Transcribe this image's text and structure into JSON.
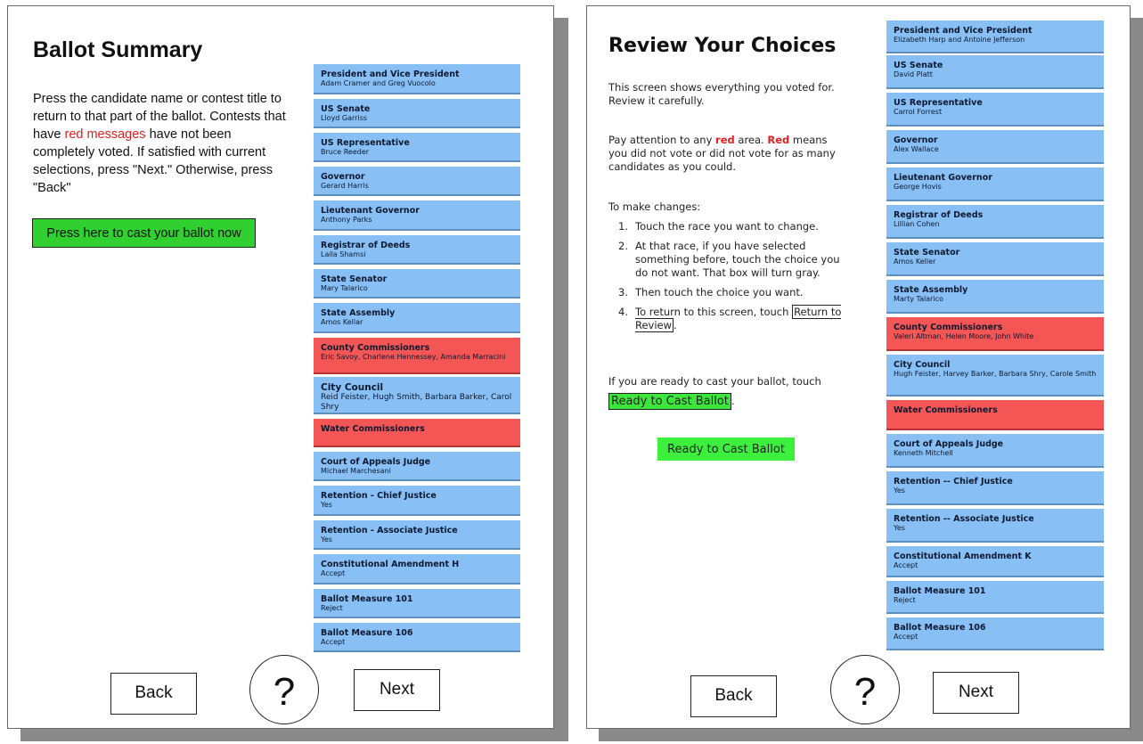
{
  "left_screen": {
    "title": "Ballot Summary",
    "instructions": {
      "part1": "Press the candidate name or contest title to return to that part of the ballot. Contests that have ",
      "red": "red messages",
      "part2": " have not been completely voted.  If satisfied with current selections, press \"Next.\" Otherwise, press \"Back\""
    },
    "cast_button": "Press here to cast your ballot now",
    "contests": [
      {
        "title": "President and Vice President",
        "choice": "Adam Cramer and Greg Vuocolo",
        "status": "voted"
      },
      {
        "title": "US Senate",
        "choice": "Lloyd Garriss",
        "status": "voted"
      },
      {
        "title": "US Representative",
        "choice": "Bruce Reeder",
        "status": "voted"
      },
      {
        "title": "Governor",
        "choice": "Gerard Harris",
        "status": "voted"
      },
      {
        "title": "Lieutenant Governor",
        "choice": "Anthony Parks",
        "status": "voted"
      },
      {
        "title": "Registrar of Deeds",
        "choice": "Laila Shamsi",
        "status": "voted"
      },
      {
        "title": "State Senator",
        "choice": "Mary Talarico",
        "status": "voted"
      },
      {
        "title": "State Assembly",
        "choice": "Amos Kellar",
        "status": "voted"
      },
      {
        "title": "County Commissioners",
        "choice": "Eric Savoy, Charlene Hennessey, Amanda Marracini",
        "status": "incomplete"
      },
      {
        "title": "City Council",
        "choice": "Reid Feister, Hugh Smith, Barbara Barker, Carol Shry",
        "status": "voted"
      },
      {
        "title": "Water Commissioners",
        "choice": "",
        "status": "incomplete"
      },
      {
        "title": "Court of Appeals Judge",
        "choice": "Michael Marchesani",
        "status": "voted"
      },
      {
        "title": "Retention - Chief Justice",
        "choice": "Yes",
        "status": "voted"
      },
      {
        "title": "Retention - Associate Justice",
        "choice": "Yes",
        "status": "voted"
      },
      {
        "title": "Constitutional Amendment H",
        "choice": "Accept",
        "status": "voted"
      },
      {
        "title": "Ballot Measure 101",
        "choice": "Reject",
        "status": "voted"
      },
      {
        "title": "Ballot Measure 106",
        "choice": "Accept",
        "status": "voted"
      }
    ],
    "nav": {
      "back": "Back",
      "help": "?",
      "next": "Next"
    }
  },
  "right_screen": {
    "title": "Review Your Choices",
    "intro": "This screen shows everything you voted for. Review it carefully.",
    "attention": {
      "part1": "Pay attention to any ",
      "red1": "red",
      "part2": " area. ",
      "red2": "Red",
      "part3": " means you did not vote or did not vote for as many candidates as you could."
    },
    "changes_heading": "To make changes:",
    "steps": [
      {
        "num": "1.",
        "text": "Touch the race you want to change."
      },
      {
        "num": "2.",
        "text": "At that race, if you have selected something before, touch the choice you do not want. That box will turn gray."
      },
      {
        "num": "3.",
        "text": "Then touch the choice you want."
      },
      {
        "num": "4.",
        "text_before": "To return to this screen, touch ",
        "link": "Return to Review",
        "text_after": "."
      }
    ],
    "ready_text": "If you are ready to cast your ballot, touch",
    "ready_inline": "Ready to Cast Ballot",
    "ready_period": ".",
    "ready_button": "Ready to Cast Ballot",
    "contests": [
      {
        "title": "President and Vice President",
        "choice": "Elizabeth Harp and Antoine Jefferson",
        "status": "voted"
      },
      {
        "title": "US Senate",
        "choice": "David Platt",
        "status": "voted"
      },
      {
        "title": "US Representative",
        "choice": "Carrol Forrest",
        "status": "voted"
      },
      {
        "title": "Governor",
        "choice": "Alex Wallace",
        "status": "voted"
      },
      {
        "title": "Lieutenant Governor",
        "choice": "George Hovis",
        "status": "voted"
      },
      {
        "title": "Registrar of Deeds",
        "choice": "Lillian Cohen",
        "status": "voted"
      },
      {
        "title": "State Senator",
        "choice": "Amos Keller",
        "status": "voted"
      },
      {
        "title": "State Assembly",
        "choice": "Marty Talarico",
        "status": "voted"
      },
      {
        "title": "County Commissioners",
        "choice": "Valeri Altman, Helen Moore, John White",
        "status": "incomplete"
      },
      {
        "title": "City Council",
        "choice": "Hugh Feister, Harvey Barker, Barbara Shry, Carole Smith",
        "status": "voted"
      },
      {
        "title": "Water Commissioners",
        "choice": "",
        "status": "incomplete"
      },
      {
        "title": "Court of Appeals Judge",
        "choice": "Kenneth Mitchell",
        "status": "voted"
      },
      {
        "title": "Retention -- Chief Justice",
        "choice": "Yes",
        "status": "voted"
      },
      {
        "title": "Retention -- Associate Justice",
        "choice": "Yes",
        "status": "voted"
      },
      {
        "title": "Constitutional Amendment K",
        "choice": "Accept",
        "status": "voted"
      },
      {
        "title": "Ballot Measure 101",
        "choice": "Reject",
        "status": "voted"
      },
      {
        "title": "Ballot Measure 106",
        "choice": "Accept",
        "status": "voted"
      }
    ],
    "nav": {
      "back": "Back",
      "help": "?",
      "next": "Next"
    }
  },
  "colors": {
    "voted": "#88bff5",
    "incomplete": "#f45555",
    "cast_green": "#2fd02f",
    "ready_green": "#3df03d"
  }
}
